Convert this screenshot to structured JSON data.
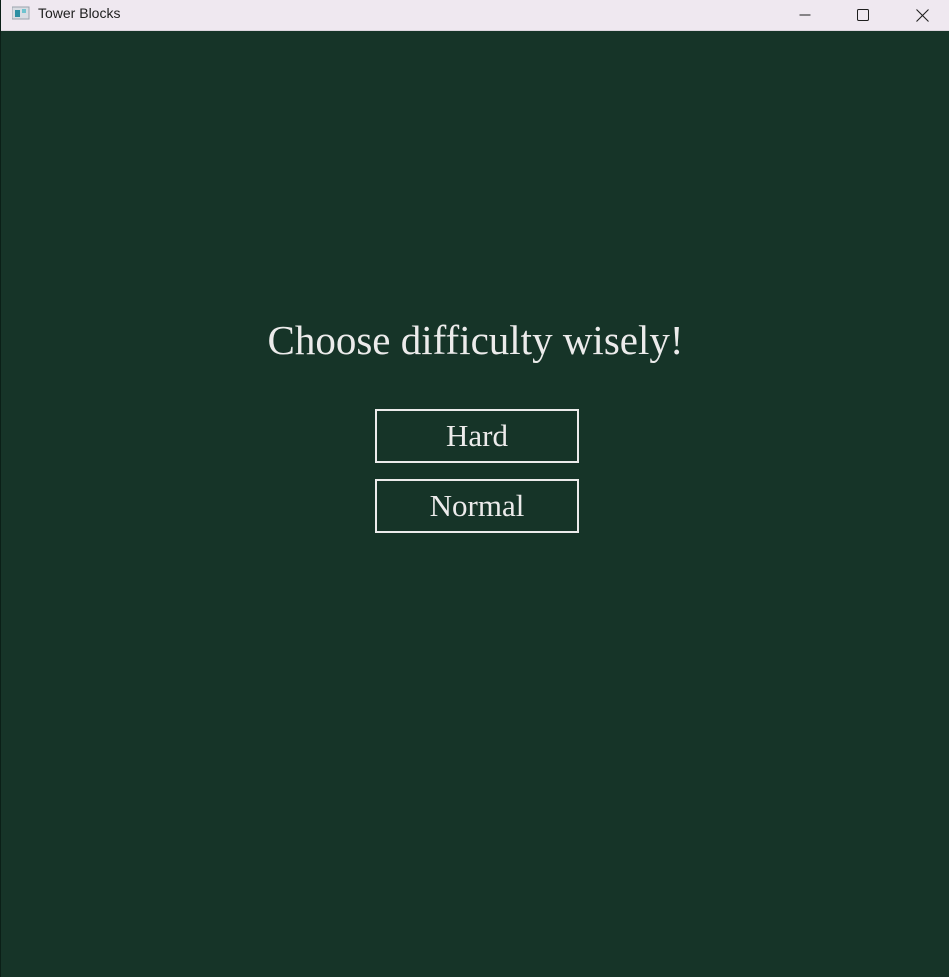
{
  "window": {
    "title": "Tower Blocks",
    "controls": {
      "minimize": "minimize-icon",
      "maximize": "maximize-icon",
      "close": "close-icon"
    }
  },
  "menu": {
    "heading": "Choose difficulty wisely!",
    "buttons": {
      "hard": "Hard",
      "normal": "Normal"
    }
  },
  "colors": {
    "background": "#163428",
    "text": "#ecebeb",
    "titlebar": "#efe8f0"
  }
}
